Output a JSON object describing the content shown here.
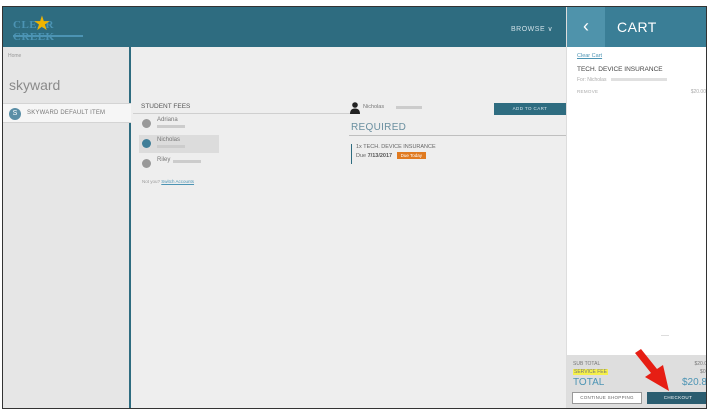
{
  "header": {
    "logo_text": "CLEAR CREEK",
    "browse_label": "BROWSE ∨"
  },
  "sidebar": {
    "crumb": "Home",
    "app_title": "skyward",
    "items": [
      {
        "icon_letter": "S",
        "label": "SKYWARD DEFAULT ITEM"
      }
    ]
  },
  "students": {
    "title": "STUDENT FEES",
    "list": [
      {
        "name": "Adriana",
        "selected": false
      },
      {
        "name": "Nicholas",
        "selected": true
      },
      {
        "name": "Riley",
        "selected": false
      }
    ],
    "not_you_prefix": "Not you?",
    "not_you_link": "Switch Accounts"
  },
  "main": {
    "user_name": "Nicholas",
    "add_to_cart_label": "ADD TO CART",
    "required_heading": "REQUIRED",
    "fee": {
      "name": "1x TECH. DEVICE INSURANCE",
      "due_label": "Due",
      "due_date": "7/13/2017",
      "badge": "Due Today"
    }
  },
  "cart": {
    "back_glyph": "‹",
    "title": "CART",
    "clear_label": "Clear Cart",
    "item_name": "TECH. DEVICE INSURANCE",
    "item_for": "For: Nicholas",
    "remove_label": "REMOVE",
    "item_price": "$20.00",
    "subtotal_label": "SUB TOTAL",
    "subtotal_value": "$20.0",
    "service_fee_label": "SERVICE FEE",
    "service_fee_value": "$0.",
    "total_label": "TOTAL",
    "total_value": "$20.8",
    "continue_label": "CONTINUE SHOPPING",
    "checkout_label": "CHECKOUT"
  },
  "colors": {
    "header": "#2e6c80",
    "accent": "#4c94b4",
    "badge": "#e07a20",
    "highlight": "#f5f04a",
    "annotation_arrow": "#e61e14"
  }
}
